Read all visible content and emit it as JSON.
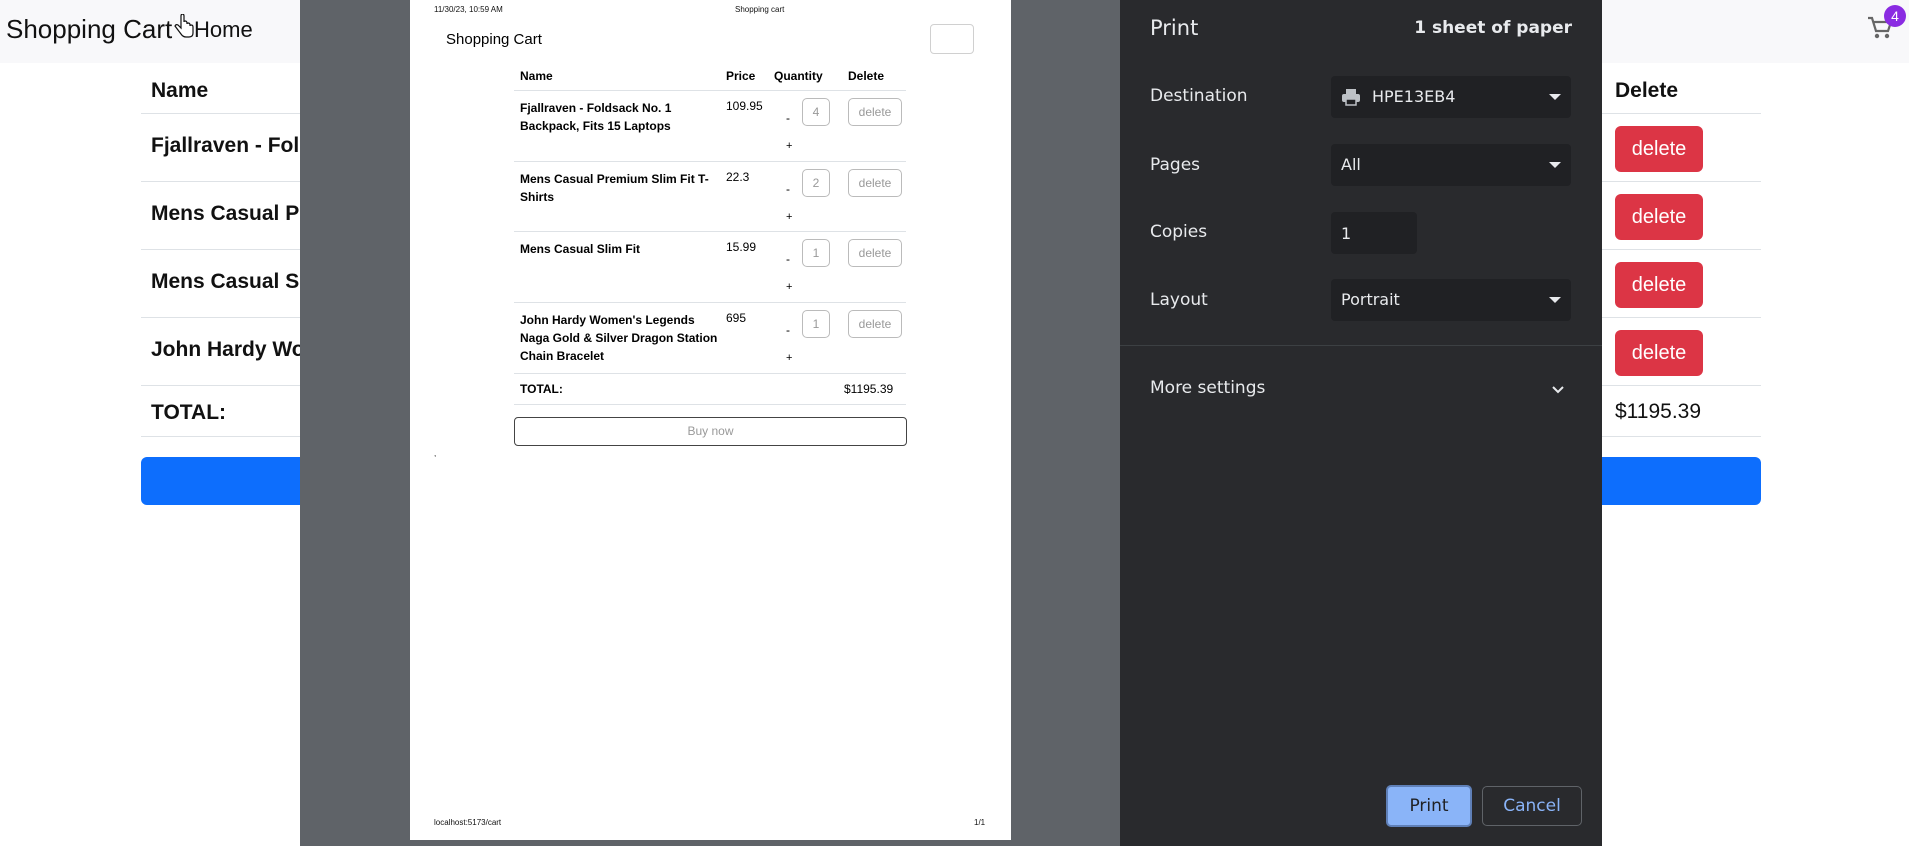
{
  "app": {
    "brand": "Shopping Cart",
    "home": "Home",
    "cart_count": "4"
  },
  "table": {
    "headers": {
      "name": "Name",
      "delete": "Delete"
    },
    "rows": [
      {
        "name": "Fjallraven - Fold",
        "delete": "delete"
      },
      {
        "name": "Mens Casual Pre",
        "delete": "delete"
      },
      {
        "name": "Mens Casual Slir",
        "delete": "delete"
      },
      {
        "name": "John Hardy Wor",
        "delete": "delete"
      }
    ],
    "total_label": "TOTAL:",
    "total_value": "$1195.39"
  },
  "preview": {
    "header_left": "11/30/23, 10:59 AM",
    "header_center": "Shopping cart",
    "title": "Shopping Cart",
    "columns": {
      "name": "Name",
      "price": "Price",
      "quantity": "Quantity",
      "delete": "Delete"
    },
    "items": [
      {
        "name": "Fjallraven - Foldsack No. 1 Backpack, Fits 15 Laptops",
        "price": "109.95",
        "qty": "4",
        "minus": "-",
        "plus": "+",
        "delete": "delete"
      },
      {
        "name": "Mens Casual Premium Slim Fit T-Shirts",
        "price": "22.3",
        "qty": "2",
        "minus": "-",
        "plus": "+",
        "delete": "delete"
      },
      {
        "name": "Mens Casual Slim Fit",
        "price": "15.99",
        "qty": "1",
        "minus": "-",
        "plus": "+",
        "delete": "delete"
      },
      {
        "name": "John Hardy Women's Legends Naga Gold & Silver Dragon Station Chain Bracelet",
        "price": "695",
        "qty": "1",
        "minus": "-",
        "plus": "+",
        "delete": "delete"
      }
    ],
    "total_label": "TOTAL:",
    "total_value": "$1195.39",
    "buy": "Buy now",
    "stray_mark": ",",
    "footer_left": "localhost:5173/cart",
    "footer_right": "1/1"
  },
  "print": {
    "title": "Print",
    "sheets": "1 sheet of paper",
    "destination_label": "Destination",
    "destination_value": "HPE13EB4",
    "pages_label": "Pages",
    "pages_value": "All",
    "copies_label": "Copies",
    "copies_value": "1",
    "layout_label": "Layout",
    "layout_value": "Portrait",
    "more_settings": "More settings",
    "print_button": "Print",
    "cancel_button": "Cancel"
  },
  "colors": {
    "delete_red": "#dc3545",
    "primary_blue": "#0d6efd",
    "badge_purple": "#8a2be2",
    "dialog_bg": "#292a2d",
    "print_blue": "#8ab4f8"
  },
  "icons": [
    "cursor-hand-icon",
    "cart-icon",
    "printer-icon",
    "caret-down-icon",
    "chevron-down-icon"
  ]
}
